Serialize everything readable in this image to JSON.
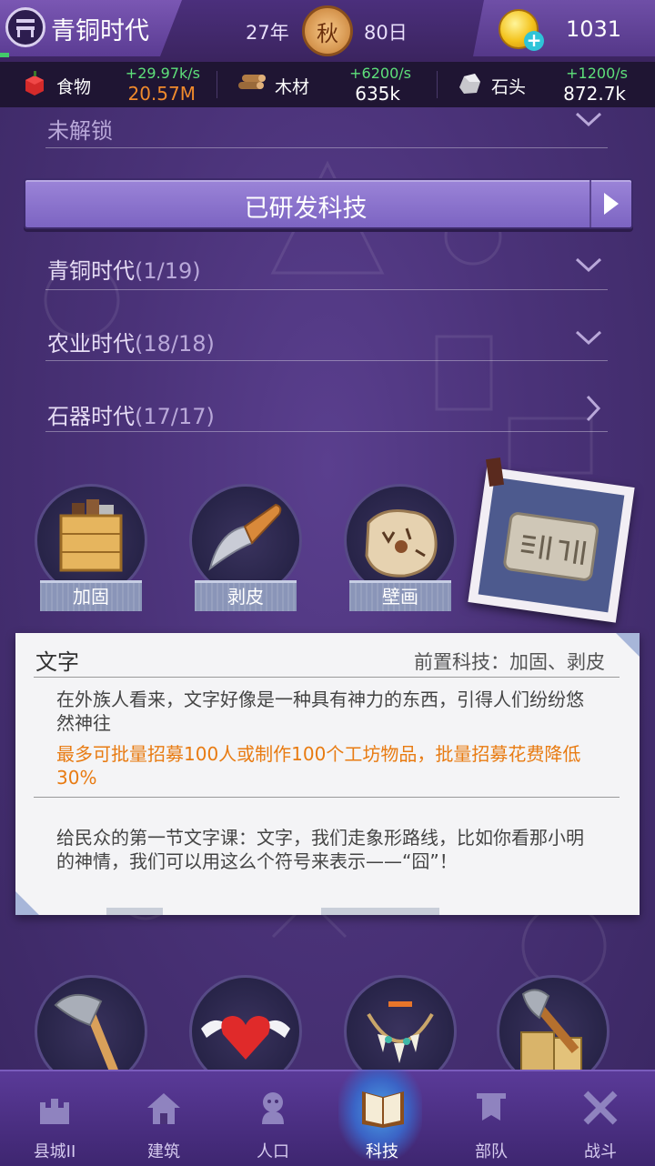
{
  "header": {
    "era_name": "青铜时代",
    "year": "27年",
    "season": "秋",
    "day": "80日",
    "gold": "1031"
  },
  "resources": [
    {
      "icon": "food-icon",
      "label": "食物",
      "rate": "+29.97k/s",
      "amount": "20.57M",
      "amount_color": "#f08a2c"
    },
    {
      "icon": "wood-icon",
      "label": "木材",
      "rate": "+6200/s",
      "amount": "635k",
      "amount_color": "#ffffff"
    },
    {
      "icon": "stone-icon",
      "label": "石头",
      "rate": "+1200/s",
      "amount": "872.7k",
      "amount_color": "#ffffff"
    }
  ],
  "sections": {
    "locked": "未解锁",
    "researched_button": "已研发科技",
    "eras": [
      {
        "name": "青铜时代",
        "count": "(1/19)"
      },
      {
        "name": "农业时代",
        "count": "(18/18)"
      },
      {
        "name": "石器时代",
        "count": "(17/17)"
      }
    ]
  },
  "techs_row1": [
    {
      "name": "加固",
      "icon": "crate-icon"
    },
    {
      "name": "剥皮",
      "icon": "knife-icon"
    },
    {
      "name": "壁画",
      "icon": "mural-icon"
    }
  ],
  "selected_tech_icon": "tablet-icon",
  "info_panel": {
    "title": "文字",
    "prereq": "前置科技：加固、剥皮",
    "description": "在外族人看来，文字好像是一种具有神力的东西，引得人们纷纷悠然神往",
    "effect": "最多可批量招募100人或制作100个工坊物品，批量招募花费降低30%",
    "story": "给民众的第一节文字课：文字，我们走象形路线，比如你看那小明的神情，我们可以用这么个符号来表示——“囧”！"
  },
  "techs_row2": [
    {
      "icon": "axe-icon"
    },
    {
      "icon": "winged-heart-icon"
    },
    {
      "icon": "tooth-necklace-icon"
    },
    {
      "icon": "chopping-axe-icon"
    }
  ],
  "nav": [
    {
      "label": "县城II",
      "icon": "castle-icon"
    },
    {
      "label": "建筑",
      "icon": "house-icon"
    },
    {
      "label": "人口",
      "icon": "person-icon"
    },
    {
      "label": "科技",
      "icon": "book-icon",
      "active": true
    },
    {
      "label": "部队",
      "icon": "banner-icon"
    },
    {
      "label": "战斗",
      "icon": "crossed-swords-icon"
    }
  ]
}
